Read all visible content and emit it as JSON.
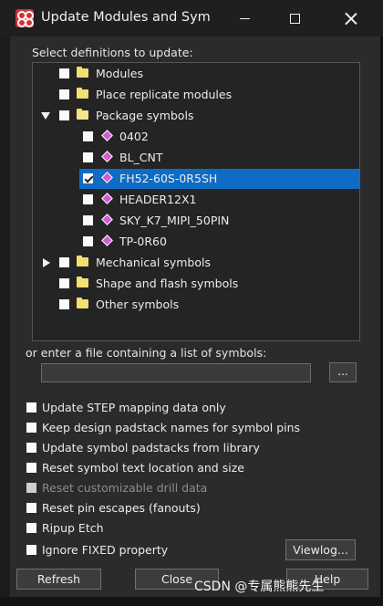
{
  "window": {
    "title": "Update Modules and Sym...",
    "minimize_label": "Minimize",
    "maximize_label": "Maximize",
    "close_label": "Close"
  },
  "section_label": "Select definitions to update:",
  "tree": [
    {
      "label": "Modules",
      "kind": "folder",
      "checked": false,
      "expander": "none"
    },
    {
      "label": "Place replicate modules",
      "kind": "folder",
      "checked": false,
      "expander": "none"
    },
    {
      "label": "Package symbols",
      "kind": "folder-open",
      "checked": false,
      "expander": "expanded"
    },
    {
      "label": "0402",
      "kind": "symbol",
      "checked": false,
      "expander": "none"
    },
    {
      "label": "BL_CNT",
      "kind": "symbol",
      "checked": false,
      "expander": "none"
    },
    {
      "label": "FH52-60S-0R5SH",
      "kind": "symbol",
      "checked": true,
      "selected": true,
      "expander": "none"
    },
    {
      "label": "HEADER12X1",
      "kind": "symbol",
      "checked": false,
      "expander": "none"
    },
    {
      "label": "SKY_K7_MIPI_50PIN",
      "kind": "symbol",
      "checked": false,
      "expander": "none"
    },
    {
      "label": "TP-0R60",
      "kind": "symbol",
      "checked": false,
      "expander": "none"
    },
    {
      "label": "Mechanical symbols",
      "kind": "folder",
      "checked": false,
      "expander": "collapsed"
    },
    {
      "label": "Shape and flash symbols",
      "kind": "folder",
      "checked": false,
      "expander": "none"
    },
    {
      "label": "Other symbols",
      "kind": "folder",
      "checked": false,
      "expander": "none"
    }
  ],
  "file_section": {
    "label": "or enter a file containing a list of symbols:",
    "value": "",
    "browse_label": "..."
  },
  "options": [
    {
      "label": "Update STEP mapping data only",
      "checked": false,
      "enabled": true
    },
    {
      "label": "Keep design padstack names for symbol pins",
      "checked": false,
      "enabled": true
    },
    {
      "label": "Update symbol padstacks from library",
      "checked": false,
      "enabled": true
    },
    {
      "label": "Reset symbol text location and size",
      "checked": false,
      "enabled": true
    },
    {
      "label": "Reset customizable drill data",
      "checked": false,
      "enabled": false
    },
    {
      "label": "Reset pin escapes (fanouts)",
      "checked": false,
      "enabled": true
    },
    {
      "label": "Ripup Etch",
      "checked": false,
      "enabled": true
    },
    {
      "label": "Ignore FIXED property",
      "checked": false,
      "enabled": true
    }
  ],
  "buttons": {
    "viewlog": "Viewlog...",
    "refresh": "Refresh",
    "close": "Close",
    "help": "Help"
  },
  "watermark": "CSDN @专属熊熊先生"
}
